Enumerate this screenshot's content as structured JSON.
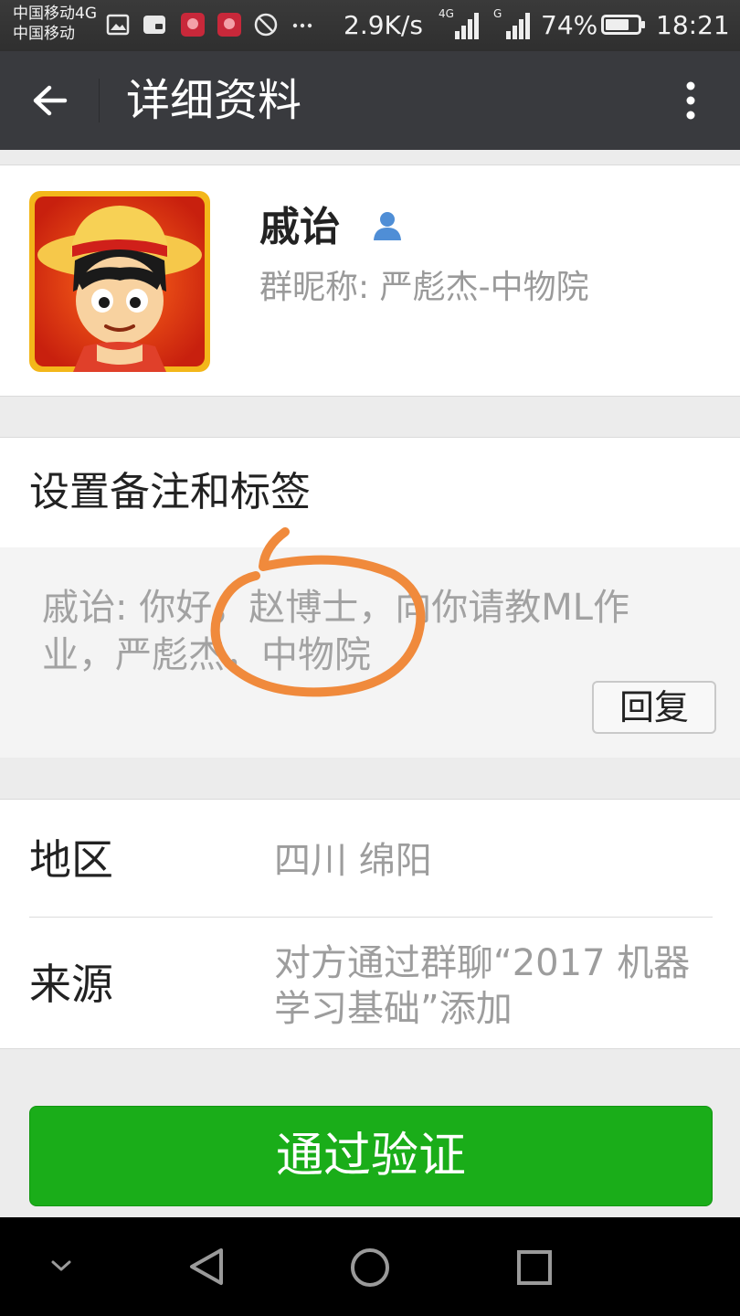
{
  "status_bar": {
    "carrier_line1": "中国移动4G",
    "carrier_line2": "中国移动",
    "speed": "2.9K/s",
    "net1": "4G",
    "net2": "G",
    "battery": "74%",
    "battery_level": 0.74,
    "time": "18:21",
    "icons": [
      "gallery-icon",
      "sim-icon",
      "huawei-icon",
      "huawei-icon",
      "blocked-icon",
      "more-dots-icon"
    ]
  },
  "app_bar": {
    "title": "详细资料",
    "back_icon": "arrow-left-icon",
    "menu_icon": "more-vertical-icon"
  },
  "profile": {
    "name": "戚诒",
    "user_icon": "person-icon",
    "group_nickname": "群昵称: 严彪杰-中物院"
  },
  "remark": {
    "title": "设置备注和标签",
    "message": "戚诒: 你好，赵博士，向你请教ML作业，严彪杰，中物院",
    "reply_label": "回复"
  },
  "details": {
    "region_label": "地区",
    "region_value": "四川  绵阳",
    "source_label": "来源",
    "source_value": "对方通过群聊“2017 机器学习基础”添加"
  },
  "verify_button": "通过验证",
  "nav": {
    "icons": [
      "chevron-down-icon",
      "back-triangle-icon",
      "home-circle-icon",
      "recents-square-icon"
    ]
  },
  "colors": {
    "app_bar": "#393a3e",
    "accent_green": "#1aad19",
    "annotation_orange": "#f08a3c",
    "user_icon_blue": "#4f8ed6"
  }
}
